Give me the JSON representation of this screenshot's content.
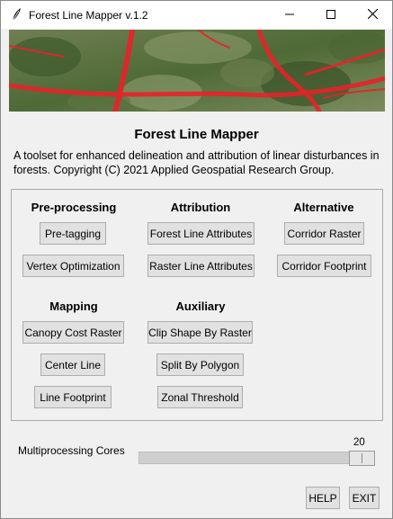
{
  "window": {
    "title": "Forest Line Mapper v.1.2"
  },
  "app": {
    "heading": "Forest Line Mapper",
    "description": "A toolset for enhanced delineation and attribution of linear disturbances in forests. Copyright (C) 2021 Applied Geospatial Research Group."
  },
  "sections": {
    "preprocessing": {
      "title": "Pre-processing",
      "buttons": [
        "Pre-tagging",
        "Vertex Optimization"
      ]
    },
    "attribution": {
      "title": "Attribution",
      "buttons": [
        "Forest Line Attributes",
        "Raster Line Attributes"
      ]
    },
    "alternative": {
      "title": "Alternative",
      "buttons": [
        "Corridor Raster",
        "Corridor Footprint"
      ]
    },
    "mapping": {
      "title": "Mapping",
      "buttons": [
        "Canopy Cost Raster",
        "Center Line",
        "Line Footprint"
      ]
    },
    "auxiliary": {
      "title": "Auxiliary",
      "buttons": [
        "Clip Shape By Raster",
        "Split By Polygon",
        "Zonal Threshold"
      ]
    }
  },
  "multiprocessing": {
    "label": "Multiprocessing Cores",
    "value": "20",
    "fraction": 1.0
  },
  "footer": {
    "help_label": "HELP",
    "exit_label": "EXIT"
  },
  "colors": {
    "line_overlay": "#e8222a",
    "forest_dark": "#3f5a2c",
    "forest_light": "#8a9a6a"
  },
  "icons": {
    "app": "feather-icon",
    "minimize": "minimize-icon",
    "maximize": "maximize-icon",
    "close": "close-icon"
  }
}
